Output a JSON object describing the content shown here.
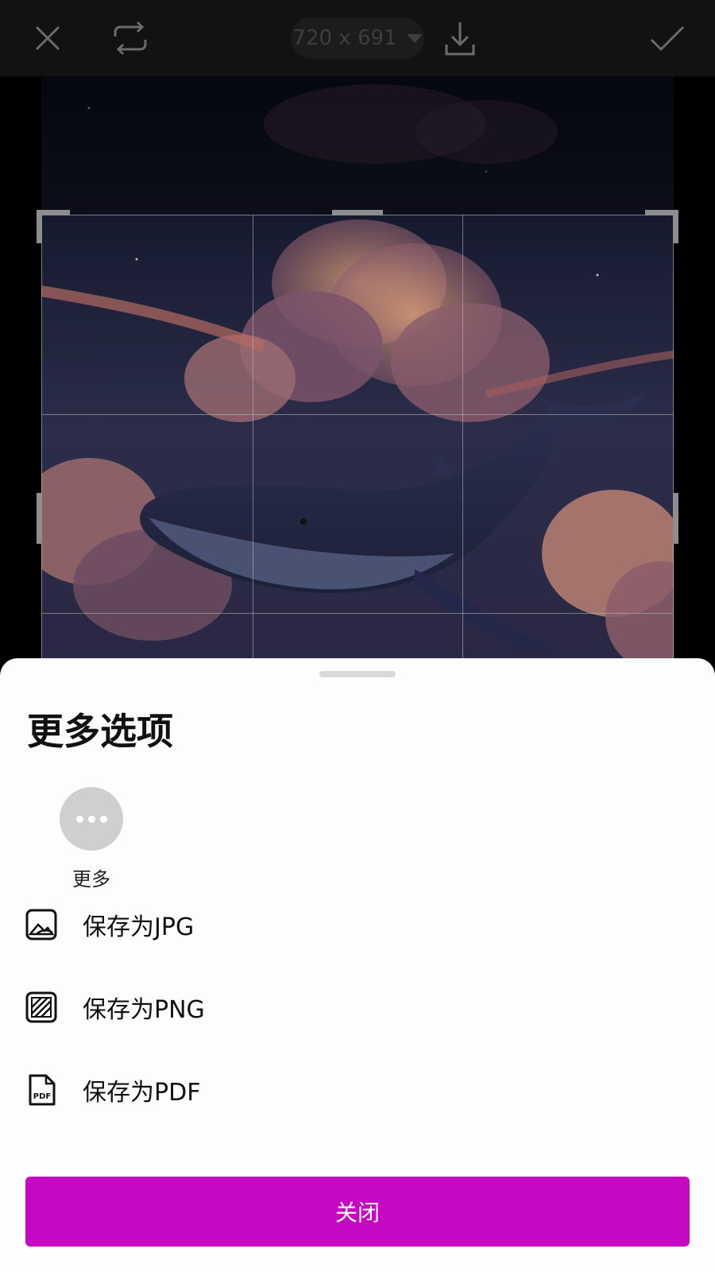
{
  "toolbar": {
    "size_label": "720 x 691",
    "icons": [
      "close-icon",
      "swap-icon",
      "chevron-down-icon",
      "download-icon",
      "check-icon"
    ]
  },
  "sheet": {
    "title": "更多选项",
    "more_label": "更多",
    "options": [
      {
        "label": "保存为JPG",
        "icon": "image-icon"
      },
      {
        "label": "保存为PNG",
        "icon": "png-pattern-icon"
      },
      {
        "label": "保存为PDF",
        "icon": "pdf-file-icon"
      }
    ],
    "close_label": "关闭"
  },
  "colors": {
    "accent": "#c509c3",
    "toolbar_bg": "#121212",
    "sheet_bg": "#fdfdfd"
  }
}
